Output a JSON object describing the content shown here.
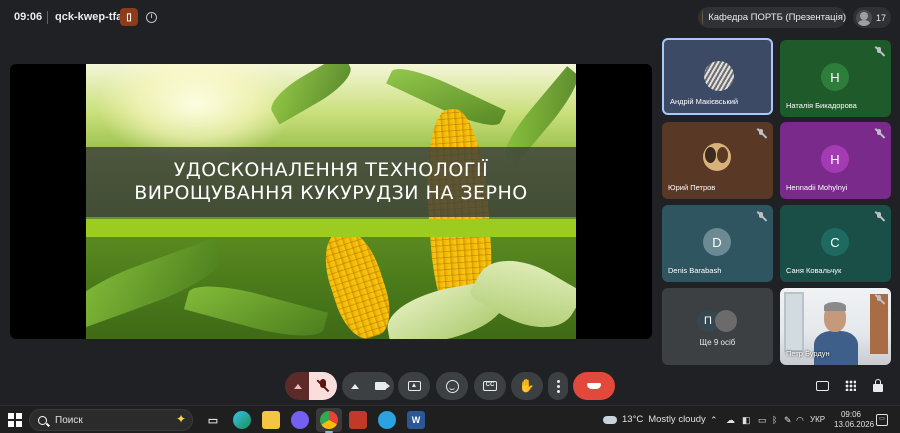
{
  "meeting": {
    "time": "09:06",
    "code": "qck-kwep-tfa",
    "host_badge_icon": "door-icon",
    "info_icon": "info-icon",
    "presenter_label": "Кафедра ПОРТБ (Презентація)",
    "participants_count": "17"
  },
  "slide": {
    "title_line1": "УДОСКОНАЛЕННЯ ТЕХНОЛОГІЇ",
    "title_line2": "ВИРОЩУВАННЯ КУКУРУДЗИ НА ЗЕРНО",
    "accent_color": "#9ccc1f"
  },
  "participants": [
    {
      "name": "Андрій Макієвський",
      "initial": "",
      "color": "#3c4a66",
      "muted": false,
      "speaking": true
    },
    {
      "name": "Наталія Бикадорова",
      "initial": "Н",
      "color": "#1e5a2a",
      "muted": true
    },
    {
      "name": "Юрий Петров",
      "initial": "",
      "color": "#5a3826",
      "muted": true
    },
    {
      "name": "Hennadii Mohylnyi",
      "initial": "H",
      "color": "#7a2a8a",
      "muted": true
    },
    {
      "name": "Denis Barabash",
      "initial": "D",
      "color": "#2f5560",
      "muted": true
    },
    {
      "name": "Саня Ковальчук",
      "initial": "С",
      "color": "#1a4f48",
      "muted": true
    },
    {
      "name": "Ще 9 осіб",
      "initial": "П",
      "color": "#3c4043",
      "muted": false
    },
    {
      "name": "Петр Бурдун",
      "initial": "",
      "color": "#e8ecf0",
      "muted": true
    }
  ],
  "controls": {
    "mic": "mic-off-icon",
    "camera": "camera-icon",
    "present": "present-screen-icon",
    "reactions": "emoji-icon",
    "captions": "captions-icon",
    "captions_text": "CC",
    "raise_hand": "hand-icon",
    "raise_hand_glyph": "✋",
    "more": "more-vertical-icon",
    "leave": "phone-hangup-icon",
    "leave_color": "#e2493c"
  },
  "side_controls": [
    "chat-icon",
    "activities-grid-icon",
    "host-controls-lock-icon"
  ],
  "taskbar": {
    "search_placeholder": "Поиск",
    "weather_temp": "13°C",
    "weather_desc": "Mostly cloudy",
    "language": "УКР",
    "clock_time": "09:06",
    "clock_date": "13.06.2026",
    "apps": [
      "task-view-icon",
      "edge-icon",
      "file-explorer-icon",
      "viber-icon",
      "chrome-icon",
      "teams-icon",
      "telegram-icon",
      "word-icon"
    ]
  }
}
